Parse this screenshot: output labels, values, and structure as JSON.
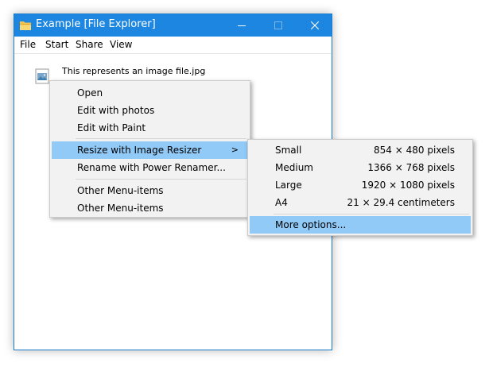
{
  "window": {
    "title": "Example [File Explorer]",
    "menu": [
      "File",
      "Start",
      "Share",
      "View"
    ]
  },
  "file": {
    "name": "This represents an image file.jpg",
    "icon": "image-file-icon"
  },
  "context_menu": {
    "items": [
      {
        "label": "Open"
      },
      {
        "label": "Edit with photos"
      },
      {
        "label": "Edit with Paint"
      },
      {
        "label": "Resize with Image Resizer",
        "has_submenu": true,
        "arrow": ">"
      },
      {
        "label": "Rename with Power Renamer..."
      },
      {
        "label": "Other Menu-items"
      },
      {
        "label": "Other Menu-items"
      }
    ]
  },
  "submenu": {
    "items": [
      {
        "name": "Small",
        "value": "854 × 480 pixels"
      },
      {
        "name": "Medium",
        "value": "1366 × 768 pixels"
      },
      {
        "name": "Large",
        "value": "1920 × 1080 pixels"
      },
      {
        "name": "A4",
        "value": "21 × 29.4 centimeters"
      }
    ],
    "more": "More options..."
  },
  "colors": {
    "titlebar": "#1c86e0",
    "highlight": "#91c9f7",
    "menu_bg": "#f2f2f2"
  }
}
